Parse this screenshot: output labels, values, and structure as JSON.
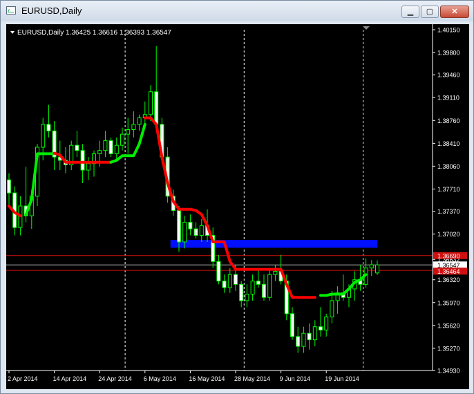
{
  "window": {
    "title": "EURUSD,Daily",
    "buttons": {
      "minimize": "▁",
      "maximize": "▢",
      "close": "✕"
    }
  },
  "header": {
    "text": "EURUSD,Daily  1.36425 1.36616 1.36393 1.36547"
  },
  "chart_data": {
    "type": "candlestick",
    "symbol": "EURUSD",
    "timeframe": "Daily",
    "ohlc_current": {
      "open": 1.36425,
      "high": 1.36616,
      "low": 1.36393,
      "close": 1.36547
    },
    "ylim": [
      1.3493,
      1.4015
    ],
    "y_ticks": [
      "1.40150",
      "1.39800",
      "1.39460",
      "1.39110",
      "1.38760",
      "1.38410",
      "1.38060",
      "1.37710",
      "1.37370",
      "1.37020",
      "1.36632",
      "1.36320",
      "1.35970",
      "1.35620",
      "1.35270",
      "1.34930"
    ],
    "x_tick_labels": [
      {
        "label": "2 Apr 2014",
        "index": 0
      },
      {
        "label": "14 Apr 2014",
        "index": 8
      },
      {
        "label": "24 Apr 2014",
        "index": 16
      },
      {
        "label": "6 May 2014",
        "index": 24
      },
      {
        "label": "16 May 2014",
        "index": 32
      },
      {
        "label": "28 May 2014",
        "index": 40
      },
      {
        "label": "9 Jun 2014",
        "index": 48
      },
      {
        "label": "19 Jun 2014",
        "index": 56
      }
    ],
    "month_separators": [
      21,
      42,
      63
    ],
    "price_lines": [
      {
        "price": 1.3669,
        "color": "#d01010",
        "label": "1.36690",
        "label_bg": "#d01010",
        "label_color": "#ffffff"
      },
      {
        "price": 1.36547,
        "color": "#c0c0c0",
        "label": "1.36547",
        "label_bg": "#ffffff",
        "label_color": "#000000"
      },
      {
        "price": 1.36464,
        "color": "#d01010",
        "label": "1.36464",
        "label_bg": "#d01010",
        "label_color": "#ffffff"
      }
    ],
    "zone": {
      "x_start": 29,
      "x_end": 65,
      "top": 1.3693,
      "bottom": 1.3681,
      "color": "#0010ff"
    },
    "candles": [
      [
        1.3785,
        1.3795,
        1.3745,
        1.3765
      ],
      [
        1.3765,
        1.3775,
        1.37,
        1.3712
      ],
      [
        1.3712,
        1.376,
        1.37,
        1.3745
      ],
      [
        1.3745,
        1.3805,
        1.372,
        1.373
      ],
      [
        1.373,
        1.377,
        1.371,
        1.376
      ],
      [
        1.376,
        1.384,
        1.3745,
        1.3835
      ],
      [
        1.3835,
        1.388,
        1.3815,
        1.387
      ],
      [
        1.387,
        1.39,
        1.385,
        1.386
      ],
      [
        1.386,
        1.3875,
        1.38,
        1.382
      ],
      [
        1.382,
        1.3845,
        1.38,
        1.3815
      ],
      [
        1.3815,
        1.3835,
        1.3795,
        1.3808
      ],
      [
        1.3808,
        1.3845,
        1.38,
        1.3838
      ],
      [
        1.3838,
        1.386,
        1.382,
        1.383
      ],
      [
        1.383,
        1.384,
        1.378,
        1.38
      ],
      [
        1.38,
        1.382,
        1.3785,
        1.381
      ],
      [
        1.381,
        1.383,
        1.379,
        1.3825
      ],
      [
        1.3825,
        1.3845,
        1.3805,
        1.383
      ],
      [
        1.383,
        1.386,
        1.382,
        1.3845
      ],
      [
        1.3845,
        1.385,
        1.382,
        1.3825
      ],
      [
        1.3825,
        1.385,
        1.3815,
        1.3838
      ],
      [
        1.3838,
        1.3865,
        1.383,
        1.3855
      ],
      [
        1.3855,
        1.388,
        1.3825,
        1.3862
      ],
      [
        1.3862,
        1.389,
        1.385,
        1.387
      ],
      [
        1.387,
        1.3885,
        1.386,
        1.388
      ],
      [
        1.388,
        1.3905,
        1.387,
        1.3885
      ],
      [
        1.3885,
        1.393,
        1.3875,
        1.392
      ],
      [
        1.392,
        1.399,
        1.386,
        1.387
      ],
      [
        1.387,
        1.388,
        1.381,
        1.382
      ],
      [
        1.382,
        1.3835,
        1.375,
        1.376
      ],
      [
        1.376,
        1.377,
        1.373,
        1.3738
      ],
      [
        1.3738,
        1.3745,
        1.3675,
        1.369
      ],
      [
        1.369,
        1.373,
        1.368,
        1.372
      ],
      [
        1.372,
        1.3732,
        1.37,
        1.371
      ],
      [
        1.371,
        1.372,
        1.3695,
        1.37
      ],
      [
        1.37,
        1.3725,
        1.369,
        1.3715
      ],
      [
        1.3715,
        1.374,
        1.369,
        1.37
      ],
      [
        1.37,
        1.3712,
        1.365,
        1.366
      ],
      [
        1.366,
        1.367,
        1.3625,
        1.363
      ],
      [
        1.363,
        1.364,
        1.3612,
        1.362
      ],
      [
        1.362,
        1.365,
        1.3612,
        1.364
      ],
      [
        1.364,
        1.3655,
        1.3615,
        1.3625
      ],
      [
        1.3625,
        1.363,
        1.359,
        1.36
      ],
      [
        1.36,
        1.3625,
        1.359,
        1.361
      ],
      [
        1.361,
        1.364,
        1.36,
        1.363
      ],
      [
        1.363,
        1.365,
        1.362,
        1.3625
      ],
      [
        1.3625,
        1.364,
        1.36,
        1.3605
      ],
      [
        1.3605,
        1.365,
        1.36,
        1.364
      ],
      [
        1.364,
        1.3655,
        1.363,
        1.3645
      ],
      [
        1.3645,
        1.367,
        1.3625,
        1.363
      ],
      [
        1.363,
        1.364,
        1.357,
        1.358
      ],
      [
        1.358,
        1.359,
        1.354,
        1.3545
      ],
      [
        1.3545,
        1.356,
        1.352,
        1.353
      ],
      [
        1.353,
        1.356,
        1.352,
        1.355
      ],
      [
        1.355,
        1.3565,
        1.3525,
        1.354
      ],
      [
        1.354,
        1.357,
        1.353,
        1.356
      ],
      [
        1.356,
        1.359,
        1.3545,
        1.3555
      ],
      [
        1.3555,
        1.358,
        1.3545,
        1.3575
      ],
      [
        1.3575,
        1.3615,
        1.3565,
        1.36
      ],
      [
        1.36,
        1.3622,
        1.358,
        1.3612
      ],
      [
        1.3612,
        1.364,
        1.36,
        1.3605
      ],
      [
        1.3605,
        1.3625,
        1.359,
        1.3618
      ],
      [
        1.3618,
        1.3645,
        1.36,
        1.3632
      ],
      [
        1.3632,
        1.3655,
        1.3615,
        1.3625
      ],
      [
        1.3625,
        1.3665,
        1.362,
        1.365
      ],
      [
        1.365,
        1.3662,
        1.3638,
        1.3655
      ],
      [
        1.36425,
        1.36616,
        1.36393,
        1.36547
      ]
    ],
    "trend_segments": [
      {
        "color": "#ff0000",
        "points": [
          [
            0,
            1.3745
          ],
          [
            1,
            1.3735
          ],
          [
            2,
            1.373
          ]
        ]
      },
      {
        "color": "#00ee00",
        "points": [
          [
            3,
            1.3732
          ],
          [
            4,
            1.3755
          ],
          [
            5,
            1.3825
          ],
          [
            6,
            1.3825
          ],
          [
            7,
            1.3825
          ],
          [
            8,
            1.3825
          ]
        ]
      },
      {
        "color": "#ff0000",
        "points": [
          [
            8,
            1.3826
          ],
          [
            9,
            1.3823
          ],
          [
            10,
            1.3812
          ],
          [
            11,
            1.3812
          ],
          [
            12,
            1.3812
          ],
          [
            13,
            1.3812
          ],
          [
            14,
            1.3812
          ],
          [
            15,
            1.3812
          ],
          [
            16,
            1.3812
          ],
          [
            17,
            1.3812
          ],
          [
            18,
            1.3812
          ]
        ]
      },
      {
        "color": "#00ee00",
        "points": [
          [
            18,
            1.3812
          ],
          [
            19,
            1.3815
          ],
          [
            20,
            1.3822
          ],
          [
            21,
            1.3822
          ],
          [
            22,
            1.3822
          ],
          [
            23,
            1.384
          ],
          [
            24,
            1.387
          ]
        ]
      },
      {
        "color": "#ff0000",
        "points": [
          [
            24,
            1.388
          ],
          [
            25,
            1.388
          ],
          [
            26,
            1.387
          ],
          [
            27,
            1.382
          ],
          [
            28,
            1.378
          ],
          [
            29,
            1.3752
          ],
          [
            30,
            1.374
          ],
          [
            31,
            1.374
          ],
          [
            32,
            1.374
          ],
          [
            33,
            1.3738
          ],
          [
            34,
            1.3732
          ],
          [
            35,
            1.3715
          ],
          [
            36,
            1.369
          ],
          [
            37,
            1.369
          ],
          [
            38,
            1.369
          ],
          [
            39,
            1.366
          ],
          [
            40,
            1.3648
          ],
          [
            41,
            1.3648
          ],
          [
            42,
            1.3648
          ],
          [
            43,
            1.3648
          ],
          [
            44,
            1.3648
          ],
          [
            45,
            1.3648
          ],
          [
            46,
            1.3648
          ],
          [
            47,
            1.3648
          ],
          [
            48,
            1.3648
          ],
          [
            49,
            1.3625
          ],
          [
            50,
            1.3605
          ],
          [
            51,
            1.3605
          ],
          [
            52,
            1.3605
          ],
          [
            53,
            1.3605
          ],
          [
            54,
            1.3605
          ]
        ]
      },
      {
        "color": "#00ee00",
        "points": [
          [
            55,
            1.3608
          ],
          [
            56,
            1.3608
          ],
          [
            57,
            1.361
          ],
          [
            58,
            1.361
          ],
          [
            59,
            1.361
          ],
          [
            60,
            1.3618
          ],
          [
            61,
            1.3628
          ],
          [
            62,
            1.3632
          ],
          [
            63,
            1.364
          ]
        ]
      }
    ]
  }
}
